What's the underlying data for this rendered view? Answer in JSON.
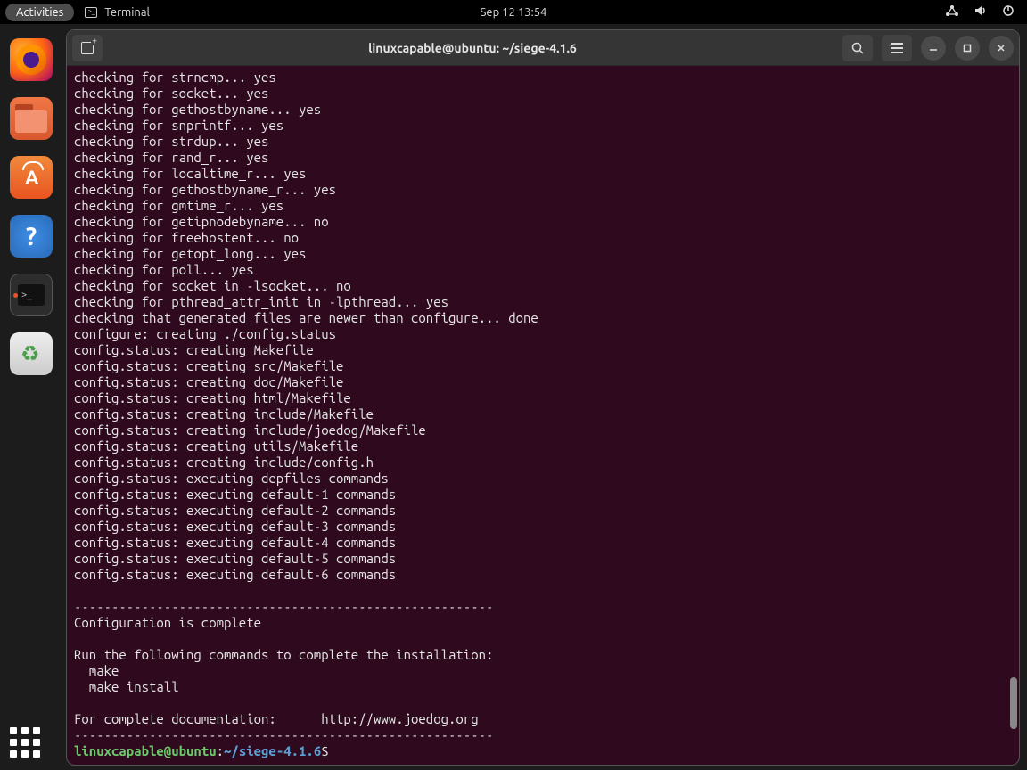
{
  "topbar": {
    "activities": "Activities",
    "app_name": "Terminal",
    "datetime": "Sep 12  13:54"
  },
  "window": {
    "title": "linuxcapable@ubuntu: ~/siege-4.1.6"
  },
  "dock": {
    "help_label": "?"
  },
  "terminal": {
    "lines": [
      "checking for strncmp... yes",
      "checking for socket... yes",
      "checking for gethostbyname... yes",
      "checking for snprintf... yes",
      "checking for strdup... yes",
      "checking for rand_r... yes",
      "checking for localtime_r... yes",
      "checking for gethostbyname_r... yes",
      "checking for gmtime_r... yes",
      "checking for getipnodebyname... no",
      "checking for freehostent... no",
      "checking for getopt_long... yes",
      "checking for poll... yes",
      "checking for socket in -lsocket... no",
      "checking for pthread_attr_init in -lpthread... yes",
      "checking that generated files are newer than configure... done",
      "configure: creating ./config.status",
      "config.status: creating Makefile",
      "config.status: creating src/Makefile",
      "config.status: creating doc/Makefile",
      "config.status: creating html/Makefile",
      "config.status: creating include/Makefile",
      "config.status: creating include/joedog/Makefile",
      "config.status: creating utils/Makefile",
      "config.status: creating include/config.h",
      "config.status: executing depfiles commands",
      "config.status: executing default-1 commands",
      "config.status: executing default-2 commands",
      "config.status: executing default-3 commands",
      "config.status: executing default-4 commands",
      "config.status: executing default-5 commands",
      "config.status: executing default-6 commands",
      "",
      "--------------------------------------------------------",
      "Configuration is complete",
      "",
      "Run the following commands to complete the installation:",
      "  make",
      "  make install",
      "",
      "For complete documentation:      http://www.joedog.org",
      "--------------------------------------------------------"
    ],
    "prompt": {
      "user_host": "linuxcapable@ubuntu",
      "separator": ":",
      "path": "~/siege-4.1.6",
      "symbol": "$"
    }
  }
}
